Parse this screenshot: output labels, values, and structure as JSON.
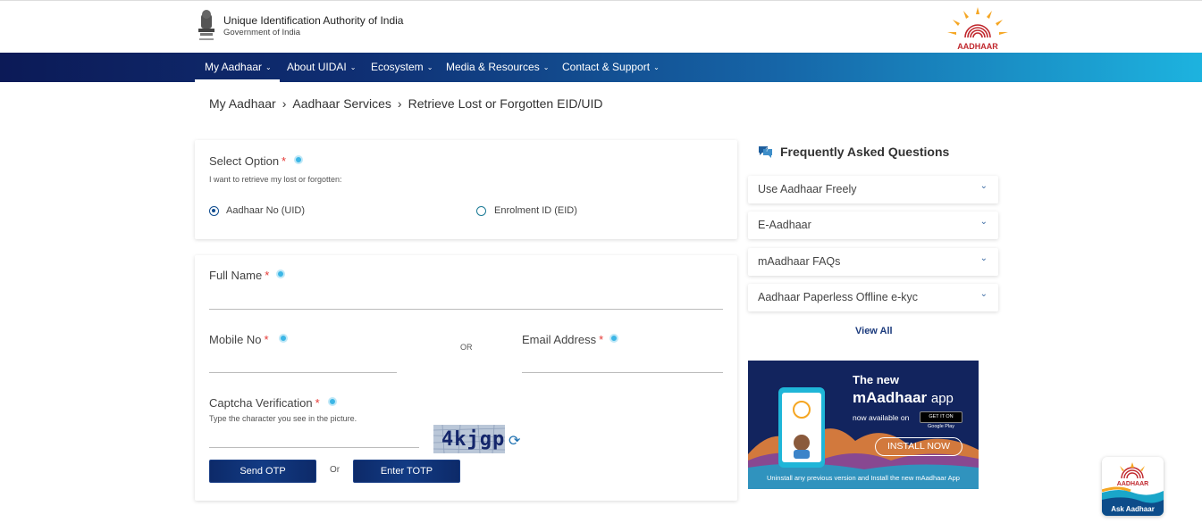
{
  "header": {
    "org_title": "Unique Identification Authority of India",
    "org_subtitle": "Government of India",
    "logo_text": "AADHAAR"
  },
  "nav": {
    "items": [
      {
        "label": "My Aadhaar",
        "active": true
      },
      {
        "label": "About UIDAI"
      },
      {
        "label": "Ecosystem"
      },
      {
        "label": "Media & Resources"
      },
      {
        "label": "Contact & Support"
      }
    ],
    "chevron": "⌄"
  },
  "breadcrumb": {
    "items": [
      "My Aadhaar",
      "Aadhaar Services",
      "Retrieve Lost or Forgotten EID/UID"
    ],
    "separator": "›"
  },
  "select_option": {
    "label": "Select Option",
    "required_mark": "*",
    "hint": "I want to retrieve my lost or forgotten:",
    "options": [
      {
        "label": "Aadhaar No (UID)",
        "selected": true
      },
      {
        "label": "Enrolment ID (EID)",
        "selected": false
      }
    ]
  },
  "form": {
    "full_name_label": "Full Name",
    "mobile_label": "Mobile No",
    "or_label": "OR",
    "email_label": "Email Address",
    "captcha_label": "Captcha Verification",
    "captcha_hint": "Type the character you see in the picture.",
    "captcha_text": "4kjgp",
    "required_mark": "*",
    "send_otp": "Send OTP",
    "buttons_or": "Or",
    "enter_totp": "Enter TOTP"
  },
  "faq": {
    "title": "Frequently Asked Questions",
    "items": [
      {
        "label": "Use Aadhaar Freely"
      },
      {
        "label": "E-Aadhaar"
      },
      {
        "label": "mAadhaar FAQs"
      },
      {
        "label": "Aadhaar Paperless Offline e-kyc"
      }
    ],
    "view_all": "View All"
  },
  "banner": {
    "line1": "The new",
    "line2_bold": "mAadhaar",
    "line2_rest": "app",
    "line3": "now available on",
    "store_label": "GET IT ON Google Play",
    "install_label": "INSTALL NOW",
    "footer": "Uninstall any previous version and Install the new mAadhaar App"
  },
  "ask_widget": {
    "logo_text": "AADHAAR",
    "label": "Ask Aadhaar"
  },
  "colors": {
    "nav_start": "#0c1a57",
    "nav_end": "#1db3df",
    "button": "#123b84",
    "required": "#e53935",
    "info": "#3cb6e6"
  }
}
